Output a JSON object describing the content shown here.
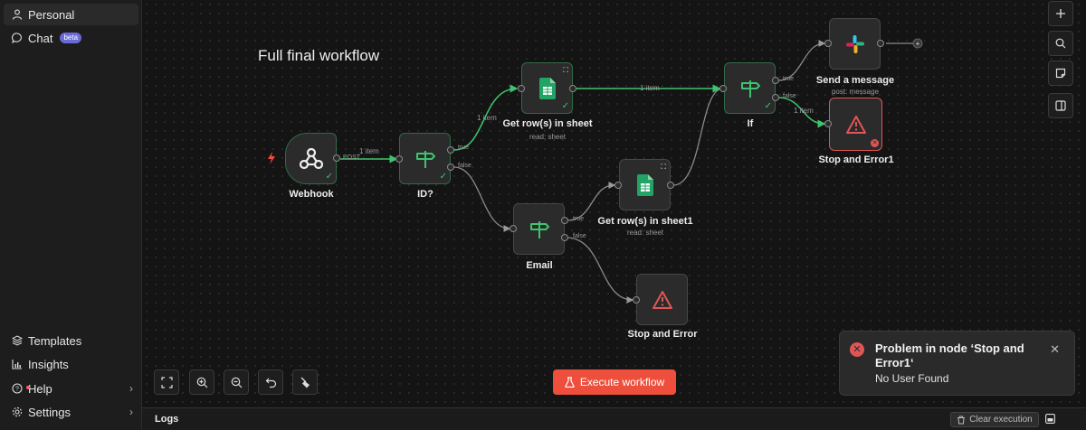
{
  "sidebar": {
    "personal": "Personal",
    "chat": "Chat",
    "chat_badge": "beta",
    "templates": "Templates",
    "insights": "Insights",
    "help": "Help",
    "settings": "Settings"
  },
  "canvas": {
    "title": "Full final workflow",
    "nodes": {
      "webhook": {
        "label": "Webhook"
      },
      "id_check": {
        "label": "ID?"
      },
      "get_rows": {
        "label": "Get row(s) in sheet",
        "sub": "read: sheet"
      },
      "email": {
        "label": "Email"
      },
      "get_rows1": {
        "label": "Get row(s) in sheet1",
        "sub": "read: sheet"
      },
      "stop_error": {
        "label": "Stop and Error"
      },
      "if": {
        "label": "If"
      },
      "send_message": {
        "label": "Send a message",
        "sub": "post: message"
      },
      "stop_error1": {
        "label": "Stop and Error1"
      }
    },
    "ports": {
      "true": "true",
      "false": "false",
      "post": "POST"
    },
    "edge_labels": {
      "webhook_to_id": "1 item",
      "id_to_sheet": "1 item",
      "sheet_to_if": "1 item",
      "if_to_error1": "1 item"
    },
    "execute_button": "Execute workflow"
  },
  "toast": {
    "title": "Problem in node ‘Stop and Error1‘",
    "message": "No User Found"
  },
  "logs": {
    "title": "Logs",
    "clear_button": "Clear execution"
  },
  "colors": {
    "success": "#3ec46d",
    "error": "#e05656",
    "execute": "#ee4f3c",
    "background": "#141414"
  }
}
